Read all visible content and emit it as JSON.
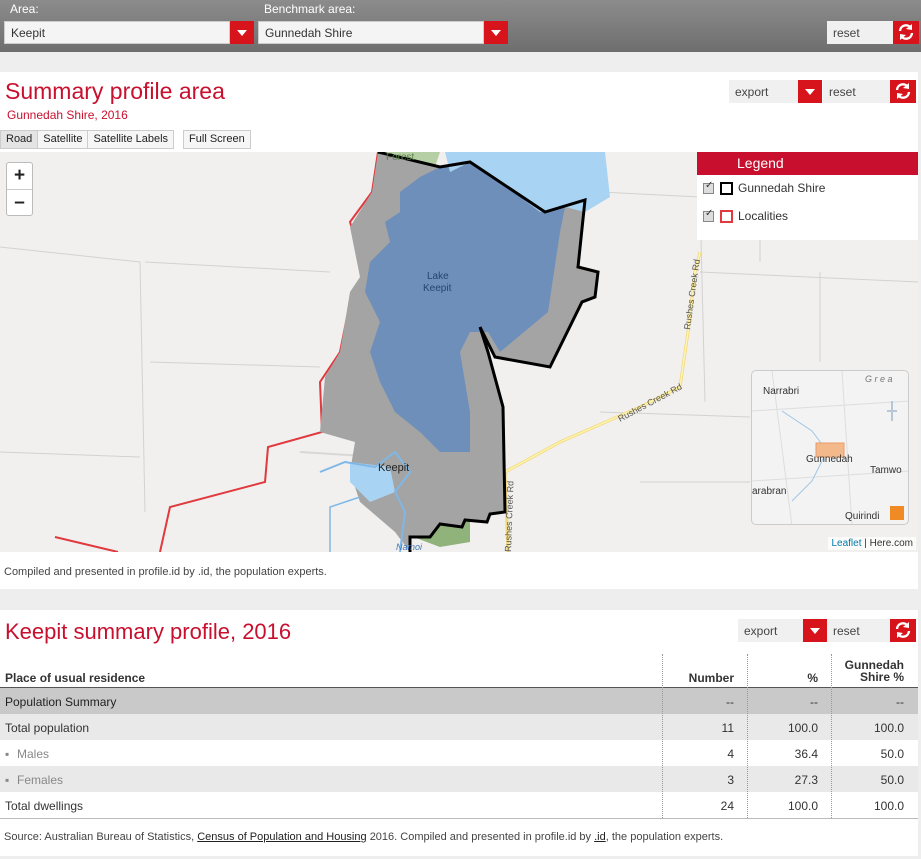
{
  "topbar": {
    "area_label": "Area:",
    "area_value": "Keepit",
    "benchmark_label": "Benchmark area:",
    "benchmark_value": "Gunnedah Shire",
    "reset_label": "reset"
  },
  "map_panel": {
    "title": "Summary profile area",
    "subtitle": "Gunnedah Shire, 2016",
    "export_label": "export",
    "reset_label": "reset",
    "map_buttons": [
      "Road",
      "Satellite",
      "Satellite Labels"
    ],
    "fullscreen_label": "Full Screen",
    "zoom_in": "+",
    "zoom_out": "–",
    "legend": {
      "title": "Legend",
      "items": [
        {
          "label": "Gunnedah Shire",
          "color": "#000000"
        },
        {
          "label": "Localities",
          "color": "#e0393e"
        }
      ]
    },
    "map_labels": {
      "forest": "Forest",
      "lake": "Lake",
      "lake2": "Keepit",
      "keepit": "Keepit",
      "rushes_creek": "Rushes Creek Rd",
      "rushes_creek2": "Rushes Creek Rd",
      "rushes_creek3": "Rushes Creek Rd",
      "namoi": "Namoi"
    },
    "minimap_labels": {
      "narrabri": "Narrabri",
      "gunnedah": "Gunnedah",
      "tamworth": "Tamwo",
      "coonabarabran": "arabran",
      "quirindi": "Quirindi",
      "great": "G r e a"
    },
    "attribution_leaflet": "Leaflet",
    "attribution_here": "| Here.com",
    "compiled_text": "Compiled and presented in profile.id by .id, the population experts."
  },
  "summary_panel": {
    "title": "Keepit summary profile, 2016",
    "export_label": "export",
    "reset_label": "reset",
    "headers": {
      "place": "Place of usual residence",
      "number": "Number",
      "percent": "%",
      "benchmark1": "Gunnedah",
      "benchmark2": "Shire %"
    },
    "rows": [
      {
        "label": "Population Summary",
        "number": "--",
        "percent": "--",
        "bench": "--",
        "type": "section"
      },
      {
        "label": "Total population",
        "number": "11",
        "percent": "100.0",
        "bench": "100.0",
        "type": "main"
      },
      {
        "label": "Males",
        "number": "4",
        "percent": "36.4",
        "bench": "50.0",
        "type": "sub"
      },
      {
        "label": "Females",
        "number": "3",
        "percent": "27.3",
        "bench": "50.0",
        "type": "sub"
      },
      {
        "label": "Total dwellings",
        "number": "24",
        "percent": "100.0",
        "bench": "100.0",
        "type": "main"
      }
    ],
    "source_prefix": "Source: Australian Bureau of Statistics,",
    "source_link": "Census of Population and Housing",
    "source_mid": "2016. Compiled and presented in profile.id by",
    "source_id": ".id",
    "source_suffix": ", the population experts."
  }
}
